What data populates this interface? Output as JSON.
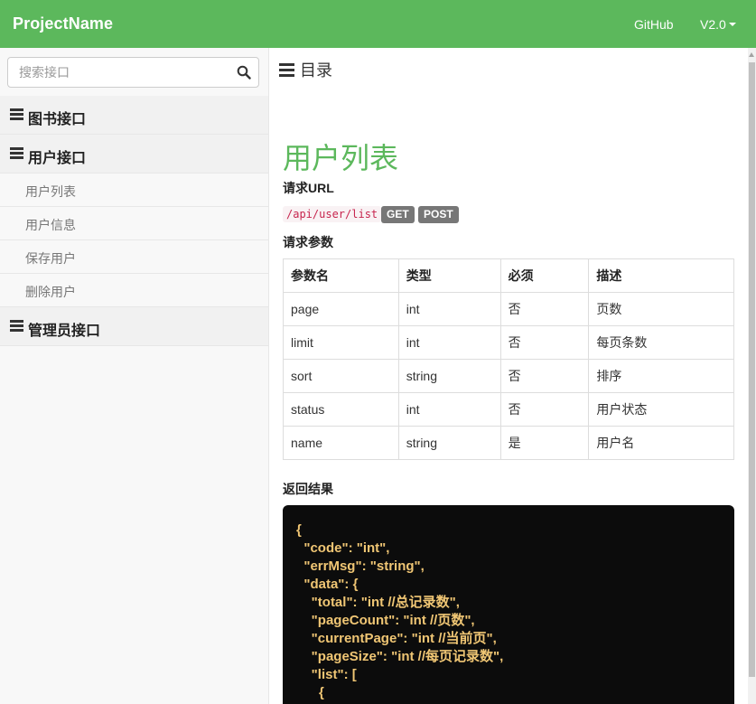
{
  "navbar": {
    "brand": "ProjectName",
    "links": {
      "github": "GitHub",
      "version": "V2.0"
    }
  },
  "sidebar": {
    "search": {
      "placeholder": "搜索接口",
      "value": ""
    },
    "groups": [
      {
        "label": "图书接口"
      },
      {
        "label": "用户接口",
        "items": [
          "用户列表",
          "用户信息",
          "保存用户",
          "删除用户"
        ]
      },
      {
        "label": "管理员接口"
      }
    ]
  },
  "main": {
    "toc": "目录",
    "title": "用户列表",
    "request_url_label": "请求URL",
    "url": "/api/user/list",
    "methods": [
      "GET",
      "POST"
    ],
    "params_label": "请求参数",
    "params_table": {
      "headers": [
        "参数名",
        "类型",
        "必须",
        "描述"
      ],
      "rows": [
        [
          "page",
          "int",
          "否",
          "页数"
        ],
        [
          "limit",
          "int",
          "否",
          "每页条数"
        ],
        [
          "sort",
          "string",
          "否",
          "排序"
        ],
        [
          "status",
          "int",
          "否",
          "用户状态"
        ],
        [
          "name",
          "string",
          "是",
          "用户名"
        ]
      ]
    },
    "result_label": "返回结果",
    "result_lines": [
      "{",
      "  \"code\": \"int\",",
      "  \"errMsg\": \"string\",",
      "  \"data\": {",
      "    \"total\": \"int //总记录数\",",
      "    \"pageCount\": \"int //页数\",",
      "    \"currentPage\": \"int //当前页\",",
      "    \"pageSize\": \"int //每页记录数\",",
      "    \"list\": [",
      "      {"
    ]
  },
  "colors": {
    "accent": "#5cb85c",
    "badge": "#777777",
    "code_bg": "#0c0c0c",
    "code_text": "#f0c674"
  }
}
